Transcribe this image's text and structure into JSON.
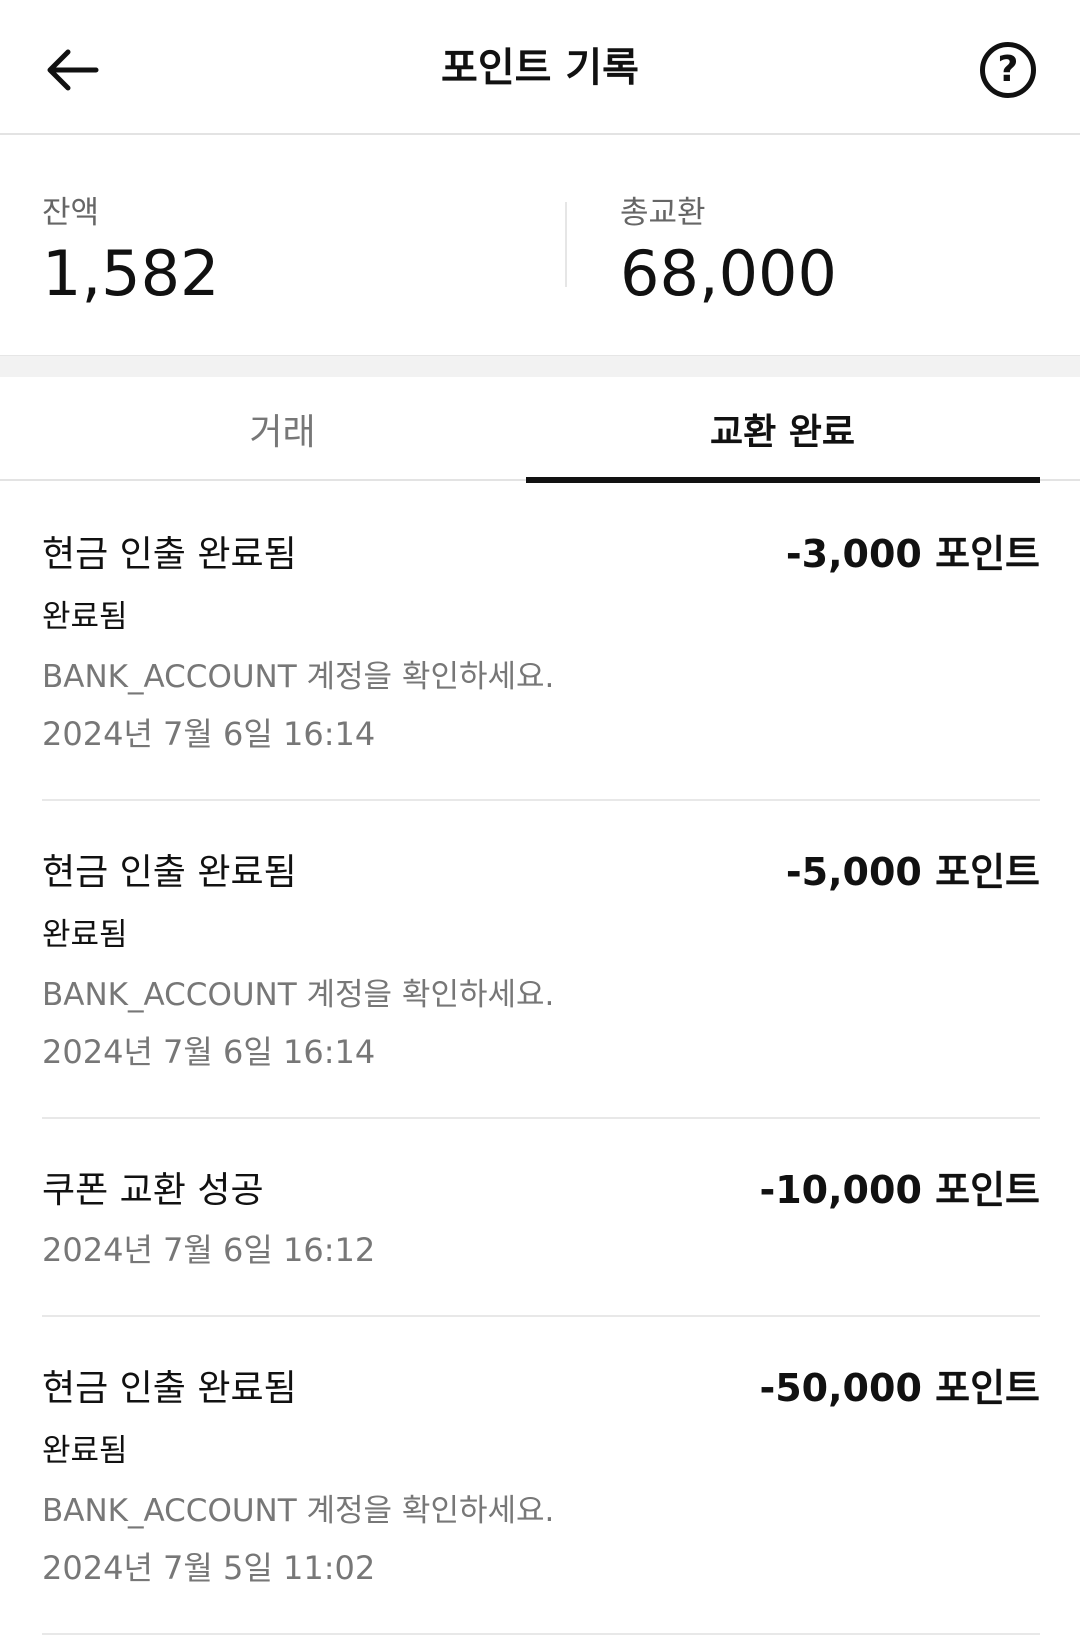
{
  "header": {
    "title": "포인트 기록",
    "back_icon": "arrow-left-icon",
    "help_icon": "question-circle-icon",
    "help_glyph": "?"
  },
  "summary": {
    "balance_label": "잔액",
    "balance_value": "1,582",
    "total_exchange_label": "총교환",
    "total_exchange_value": "68,000"
  },
  "tabs": [
    {
      "label": "거래",
      "active": false
    },
    {
      "label": "교환 완료",
      "active": true
    }
  ],
  "transactions": [
    {
      "title": "현금 인출 완료됨",
      "amount": "-3,000 포인트",
      "status": "완료됨",
      "note": "BANK_ACCOUNT 계정을 확인하세요.",
      "date": "2024년 7월 6일 16:14"
    },
    {
      "title": "현금 인출 완료됨",
      "amount": "-5,000 포인트",
      "status": "완료됨",
      "note": "BANK_ACCOUNT 계정을 확인하세요.",
      "date": "2024년 7월 6일 16:14"
    },
    {
      "title": "쿠폰 교환 성공",
      "amount": "-10,000 포인트",
      "date": "2024년 7월 6일 16:12"
    },
    {
      "title": "현금 인출 완료됨",
      "amount": "-50,000 포인트",
      "status": "완료됨",
      "note": "BANK_ACCOUNT 계정을 확인하세요.",
      "date": "2024년 7월 5일 11:02"
    }
  ]
}
